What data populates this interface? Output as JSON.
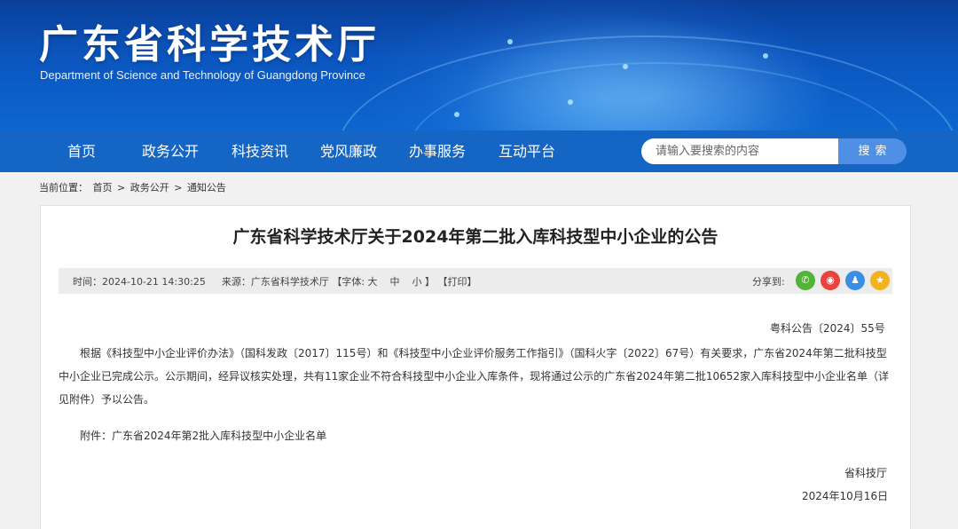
{
  "header": {
    "site_title": "广东省科学技术厅",
    "site_subtitle": "Department of Science and Technology of Guangdong Province"
  },
  "nav": {
    "items": [
      {
        "label": "首页"
      },
      {
        "label": "政务公开"
      },
      {
        "label": "科技资讯"
      },
      {
        "label": "党风廉政"
      },
      {
        "label": "办事服务"
      },
      {
        "label": "互动平台"
      }
    ],
    "search_placeholder": "请输入要搜索的内容",
    "search_button": "搜索"
  },
  "breadcrumb": {
    "prefix": "当前位置：",
    "items": [
      "首页",
      "政务公开",
      "通知公告"
    ],
    "separator": ">"
  },
  "article": {
    "title": "广东省科学技术厅关于2024年第二批入库科技型中小企业的公告",
    "meta": {
      "time_label": "时间：",
      "time": "2024-10-21 14:30:25",
      "source_label": "来源：",
      "source": "广东省科学技术厅",
      "font_label": "【字体:",
      "font_large": "大",
      "font_medium": "中",
      "font_small": "小",
      "font_close": "】",
      "print": "【打印】"
    },
    "share_label": "分享到:",
    "share_icons": [
      "wechat-icon",
      "weibo-icon",
      "qq-icon",
      "favorite-icon"
    ],
    "doc_number": "粤科公告〔2024〕55号",
    "body": "根据《科技型中小企业评价办法》（国科发政〔2017〕115号）和《科技型中小企业评价服务工作指引》（国科火字〔2022〕67号）有关要求，广东省2024年第二批科技型中小企业已完成公示。公示期间，经异议核实处理，共有11家企业不符合科技型中小企业入库条件，现将通过公示的广东省2024年第二批10652家入库科技型中小企业名单（详见附件）予以公告。",
    "attachment": "附件：广东省2024年第2批入库科技型中小企业名单",
    "signer": "省科技厅",
    "date": "2024年10月16日"
  },
  "colors": {
    "banner": "#0b56bf",
    "nav": "#1465c4",
    "search_button": "#4f8fe6"
  }
}
